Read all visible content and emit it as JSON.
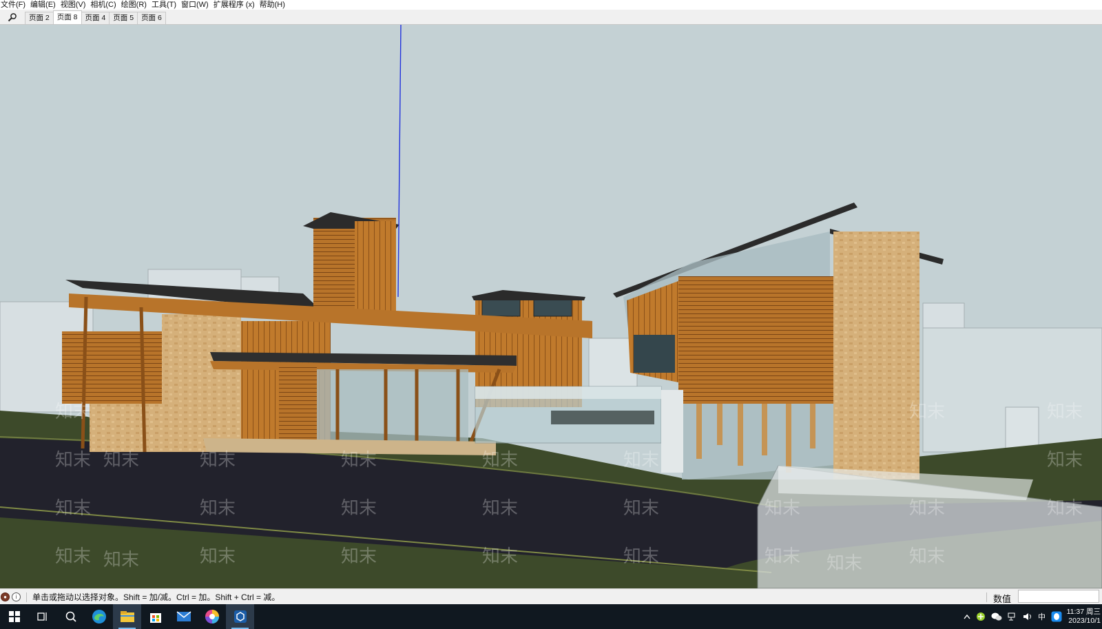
{
  "menu": [
    "文件(F)",
    "编辑(E)",
    "视图(V)",
    "相机(C)",
    "绘图(R)",
    "工具(T)",
    "窗口(W)",
    "扩展程序 (x)",
    "帮助(H)"
  ],
  "scene_tabs": [
    {
      "label": "页面 2",
      "active": false
    },
    {
      "label": "页面 8",
      "active": true
    },
    {
      "label": "页面 4",
      "active": false
    },
    {
      "label": "页面 5",
      "active": false
    },
    {
      "label": "页面 6",
      "active": false
    }
  ],
  "viewport": {
    "watermark_text": "知末",
    "sky_color": "#c4d1d4",
    "wood_color": "#b8742a",
    "roof_color": "#2b2b2b",
    "ground_color": "#3d4a2a",
    "road_color": "#22222c"
  },
  "status": {
    "hint": "单击或拖动以选择对象。Shift = 加/减。Ctrl = 加。Shift + Ctrl = 减。",
    "vcb_label": "数值",
    "vcb_value": ""
  },
  "taskbar": {
    "apps": [
      "start-icon",
      "task-view-icon",
      "search-app-icon",
      "edge-icon",
      "file-explorer-icon",
      "store-icon",
      "mail-icon",
      "color-app-icon",
      "sketchup-icon"
    ],
    "tray": {
      "ime": "中",
      "time": "11:37 周三",
      "date": "2023/10/1"
    }
  },
  "accent_colors": {
    "axis_blue": "#2233dd",
    "taskbar_bg": "#101820",
    "taskbar_highlight": "#76b9ed"
  }
}
